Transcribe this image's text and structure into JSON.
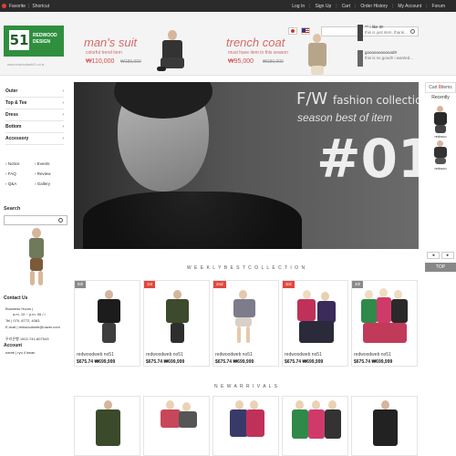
{
  "topbar": {
    "favorite": "Favorite",
    "shortcut": "Shortcut",
    "links": [
      "Log In",
      "Sign Up",
      "Cart",
      "Order History",
      "My Account",
      "Forum"
    ]
  },
  "logo": {
    "number": "51",
    "line1": "REDWOOD",
    "line2": "DESIGN",
    "sub": "www.redwoodweb51.co.kr"
  },
  "banners": [
    {
      "title": "man's suit",
      "sub": "colorful trend item",
      "price": "₩110,000",
      "old_price": "₩180,000"
    },
    {
      "title": "trench coat",
      "sub": "must have item in this season",
      "price": "₩95,000",
      "old_price": "₩180,000"
    }
  ],
  "comments": [
    {
      "line1": "^^ i like it!!",
      "line2": "this is just item, thank..."
    },
    {
      "line1": "goooooooooood!!",
      "line2": "this is so good!! i wanted..."
    }
  ],
  "sidebar": {
    "categories": [
      "Outer",
      "Top & Tee",
      "Dress",
      "Bottom",
      "Accessory"
    ],
    "links": [
      "Notice",
      "Events",
      "FAQ",
      "Review",
      "Q&A",
      "Gallery"
    ],
    "search_label": "Search",
    "contact_heading": "Contact Us",
    "contact_lines": [
      "Business Hours |",
      "a.m. 10 ~ p.m. 06 / l",
      "Tel | 070, 8772, 4083",
      "E-mail | redwoodweb@naver.com"
    ],
    "bank": "우리은행  1002-741-807543",
    "account_heading": "Account",
    "account_name": "name | ryu il hwan"
  },
  "hero": {
    "line1_big": "F/W",
    "line1_small": "fashion collection",
    "line2": "season best of item",
    "number": "#01"
  },
  "rail": {
    "cart": "Cart",
    "cart_count": "0",
    "items_label": "items",
    "recently": "Recently",
    "item_labels": [
      "redwoo",
      "redwoo"
    ],
    "prev": "◂",
    "next": "▸",
    "top": "TOP"
  },
  "weekly": {
    "title": "W E E K L Y   B E S T   C O L L E C T I O N",
    "products": [
      {
        "rank": "5th",
        "name": "redwoodweb no51",
        "price": "$675.74  ₩699,999"
      },
      {
        "rank": "1st",
        "name": "redwoodweb no51",
        "price": "$675.74  ₩699,999"
      },
      {
        "rank": "2nd",
        "name": "redwoodweb no51",
        "price": "$675.74  ₩699,999"
      },
      {
        "rank": "3rd",
        "name": "redwoodweb no51",
        "price": "$675.74  ₩699,999"
      },
      {
        "rank": "4th",
        "name": "redwoodweb no51",
        "price": "$675.74  ₩699,999"
      }
    ]
  },
  "arrivals": {
    "title": "N E W   A R R I V A L S"
  },
  "colors": {
    "accent_green": "#2f8f3f",
    "rank_gray": "#8a8a8a",
    "rank_red": "#e2473f",
    "price_red": "#d84a4a"
  }
}
